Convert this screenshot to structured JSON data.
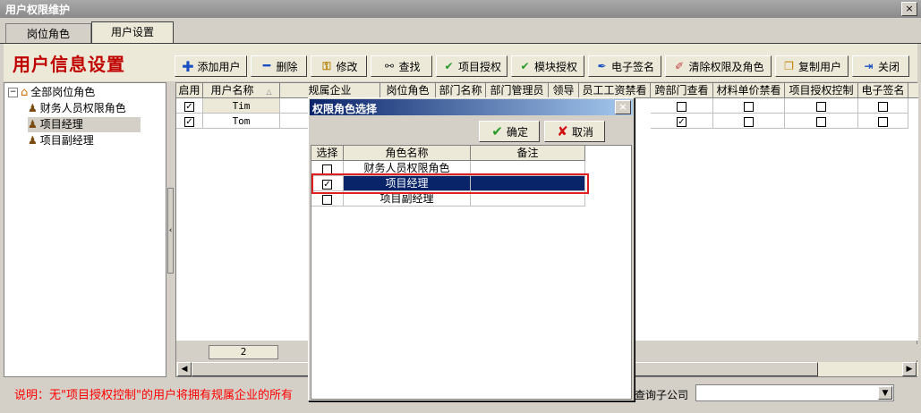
{
  "window": {
    "title": "用户权限维护",
    "close_glyph": "×"
  },
  "tabs": [
    {
      "label": "岗位角色"
    },
    {
      "label": "用户设置"
    }
  ],
  "page_title": "用户信息设置",
  "toolbar": {
    "add_user": "添加用户",
    "delete": "删除",
    "modify": "修改",
    "find": "查找",
    "project_auth": "项目授权",
    "module_auth": "模块授权",
    "e_sign": "电子签名",
    "clear_roles": "清除权限及角色",
    "copy_user": "复制用户",
    "close": "关闭"
  },
  "tree": {
    "root": "全部岗位角色",
    "items": [
      "财务人员权限角色",
      "项目经理",
      "项目副经理"
    ]
  },
  "grid": {
    "columns": [
      "启用",
      "用户名称",
      "规属企业",
      "岗位角色",
      "部门名称",
      "部门管理员",
      "领导",
      "员工工资禁看",
      "跨部门查看",
      "材料单价禁看",
      "项目授权控制",
      "电子签名"
    ],
    "rows": [
      {
        "enabled": true,
        "name": "Tim",
        "cross_dept": false
      },
      {
        "enabled": true,
        "name": "Tom",
        "cross_dept": true
      }
    ],
    "footer_count": "2"
  },
  "dialog": {
    "title": "权限角色选择",
    "close_glyph": "×",
    "ok": "确定",
    "cancel": "取消",
    "columns": [
      "选择",
      "角色名称",
      "备注"
    ],
    "rows": [
      {
        "checked": false,
        "name": "财务人员权限角色"
      },
      {
        "checked": true,
        "name": "项目经理"
      },
      {
        "checked": false,
        "name": "项目副经理"
      }
    ]
  },
  "status": {
    "note": "说明：无\"项目授权控制\"的用户将拥有规属企业的所有",
    "sub_company_label": "查询子公司",
    "sub_company_value": ""
  },
  "colors": {
    "accent_red": "#c00000",
    "note_red": "#ff0000",
    "selection": "#0a246a",
    "highlight_border": "#e02020"
  }
}
